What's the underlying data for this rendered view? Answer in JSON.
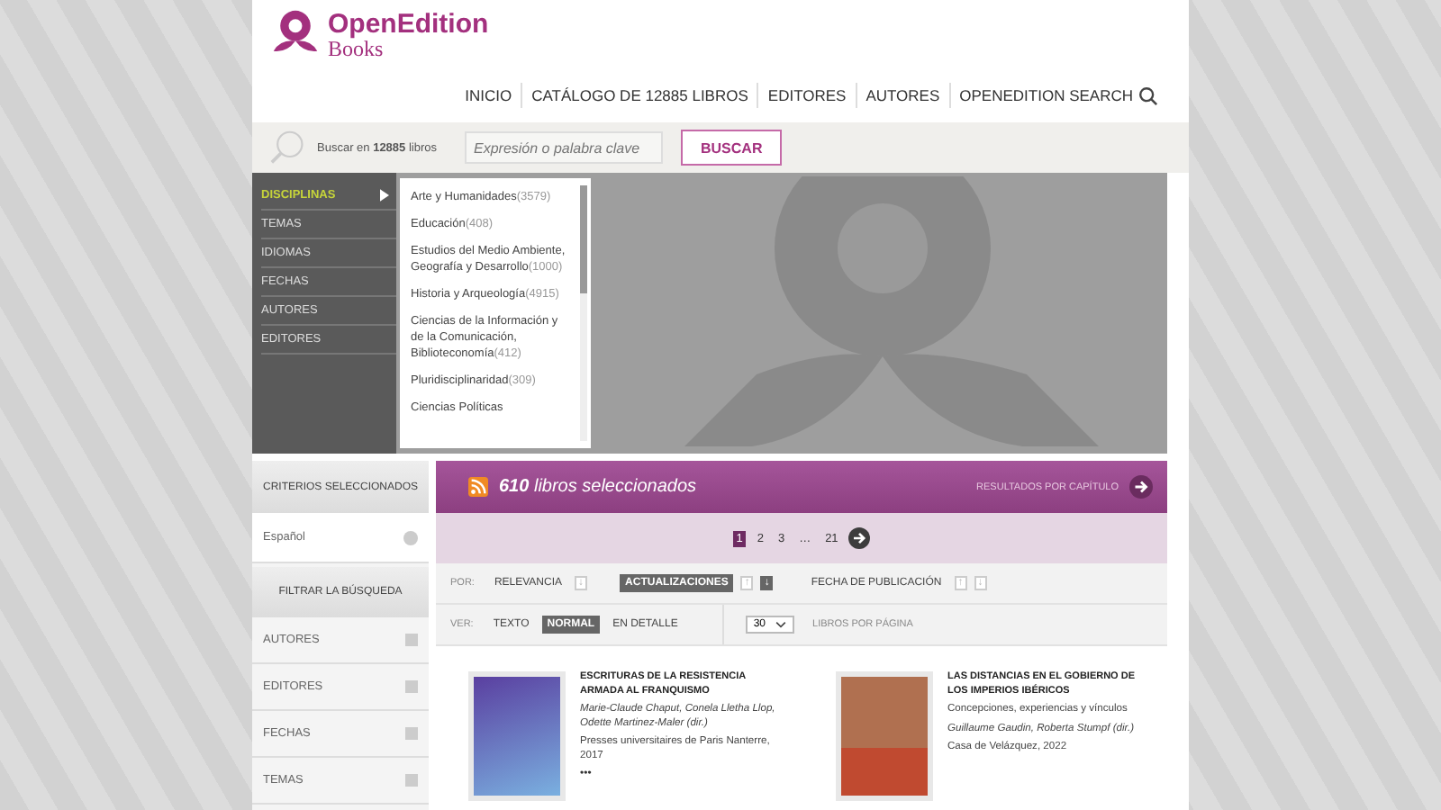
{
  "brand": {
    "name": "OpenEdition",
    "sub": "Books"
  },
  "nav": [
    {
      "label": "INICIO"
    },
    {
      "label": "CATÁLOGO DE 12885 LIBROS"
    },
    {
      "label": "EDITORES"
    },
    {
      "label": "AUTORES"
    },
    {
      "label": "OPENEDITION SEARCH",
      "search": true
    }
  ],
  "search": {
    "label": "Buscar en **12885** libros",
    "placeholder": "Expresión o palabra clave",
    "button": "BUSCAR"
  },
  "browse": [
    {
      "label": "DISCIPLINAS",
      "selected": true
    },
    {
      "label": "TEMAS",
      "selected": false
    },
    {
      "label": "IDIOMAS",
      "selected": false
    },
    {
      "label": "FECHAS",
      "selected": false
    },
    {
      "label": "AUTORES",
      "selected": false
    },
    {
      "label": "EDITORES",
      "selected": false
    }
  ],
  "disciplines": [
    {
      "name": "Arte y Humanidades",
      "count": "(3579)"
    },
    {
      "name": "Educación",
      "count": "(408)"
    },
    {
      "name": "Estudios del Medio Ambiente, Geografía y Desarrollo",
      "count": "(1000)"
    },
    {
      "name": "Historia y Arqueología",
      "count": "(4915)"
    },
    {
      "name": "Ciencias de la Información y de la Comunicación, Biblioteconomía",
      "count": "(412)"
    },
    {
      "name": "Pluridisciplinaridad",
      "count": "(309)"
    },
    {
      "name": "Ciencias Políticas"
    }
  ],
  "sidebar": {
    "criteria_title": "CRITERIOS SELECCIONADOS",
    "criteria": [
      "Español"
    ],
    "filter_title": "FILTRAR LA BÚSQUEDA",
    "filters": [
      "AUTORES",
      "EDITORES",
      "FECHAS",
      "TEMAS"
    ]
  },
  "results": {
    "count": "610",
    "label": "libros seleccionados",
    "by_chapter": "RESULTADOS POR CAPÍTULO",
    "pages": [
      {
        "label": "1",
        "selected": true
      },
      {
        "label": "2",
        "selected": false
      },
      {
        "label": "3",
        "selected": false
      },
      {
        "label": "…",
        "selected": false
      },
      {
        "label": "21",
        "selected": false
      }
    ],
    "sort_label": "POR:",
    "sort": [
      {
        "label": "RELEVANCIA",
        "selected": false,
        "arrows": [
          {
            "glyph": "↓",
            "selected": false
          }
        ]
      },
      {
        "label": "ACTUALIZACIONES",
        "selected": true,
        "arrows": [
          {
            "glyph": "↑",
            "selected": false
          },
          {
            "glyph": "↓",
            "selected": true
          }
        ]
      },
      {
        "label": "FECHA DE PUBLICACIÓN",
        "selected": false,
        "arrows": [
          {
            "glyph": "↑",
            "selected": false
          },
          {
            "glyph": "↓",
            "selected": false
          }
        ]
      }
    ],
    "view_label": "VER:",
    "views": [
      {
        "label": "TEXTO",
        "selected": false
      },
      {
        "label": "NORMAL",
        "selected": true
      },
      {
        "label": "EN DETALLE",
        "selected": false
      }
    ],
    "per_page": "30",
    "per_page_label": "LIBROS POR PÁGINA"
  },
  "books": [
    {
      "kind": "gradient",
      "title": "ESCRITURAS DE LA RESISTENCIA ARMADA AL FRANQUISMO",
      "authors": "Marie-Claude Chaput, Conela Lletha Llop, Odette Martinez-Maler (dir.)",
      "publisher": "Presses universitaires de Paris Nanterre, 2017",
      "more": "•••"
    },
    {
      "kind": "photo",
      "title": "LAS DISTANCIAS EN EL GOBIERNO DE LOS IMPERIOS IBÉRICOS",
      "subtitle": "Concepciones, experiencias y vínculos",
      "authors": "Guillaume Gaudin, Roberta Stumpf (dir.)",
      "publisher": "Casa de Velázquez, 2022"
    }
  ]
}
